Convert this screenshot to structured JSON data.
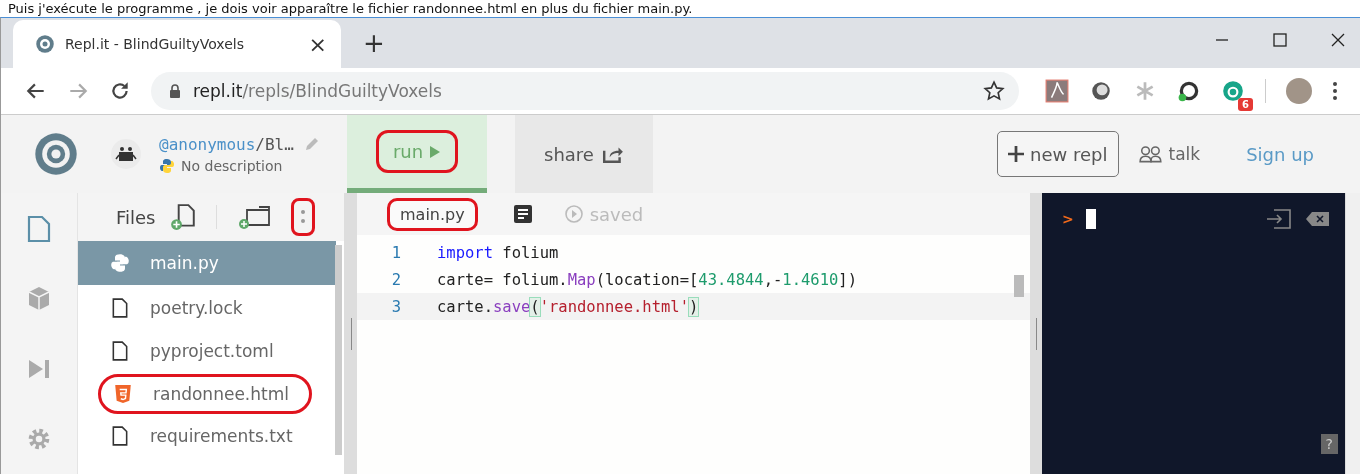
{
  "caption": "Puis j'exécute le programme , je dois voir apparaître le fichier randonnee.html en plus du fichier main.py.",
  "browser": {
    "tab_title": "Repl.it - BlindGuiltyVoxels",
    "tab_close": "×",
    "new_tab": "+",
    "url_host": "repl.it",
    "url_path": "/repls/BlindGuiltyVoxels",
    "extension_badge": "6"
  },
  "header": {
    "user": "@anonymous",
    "repl_name": "/Bl…",
    "description": "No description",
    "run": {
      "label": "run",
      "highlighted": true
    },
    "share": "share",
    "new_repl": "new repl",
    "talk": "talk",
    "sign_up": "Sign up"
  },
  "files": {
    "title": "Files",
    "menu_highlighted": true,
    "items": [
      {
        "name": "main.py",
        "kind": "python",
        "selected": true,
        "highlighted": false
      },
      {
        "name": "poetry.lock",
        "kind": "file",
        "selected": false,
        "highlighted": false
      },
      {
        "name": "pyproject.toml",
        "kind": "file",
        "selected": false,
        "highlighted": false
      },
      {
        "name": "randonnee.html",
        "kind": "html",
        "selected": false,
        "highlighted": true
      },
      {
        "name": "requirements.txt",
        "kind": "file",
        "selected": false,
        "highlighted": false
      }
    ]
  },
  "editor": {
    "tab": {
      "label": "main.py",
      "highlighted": true
    },
    "status": "saved",
    "lines": [
      {
        "number": "1",
        "tokens": [
          {
            "kind": "keyword",
            "text": "import"
          },
          {
            "kind": "plain",
            "text": " folium"
          }
        ]
      },
      {
        "number": "2",
        "tokens": [
          {
            "kind": "plain",
            "text": "carte= folium."
          },
          {
            "kind": "function",
            "text": "Map"
          },
          {
            "kind": "plain",
            "text": "(location=["
          },
          {
            "kind": "number",
            "text": "43.4844"
          },
          {
            "kind": "plain",
            "text": ",-"
          },
          {
            "kind": "number",
            "text": "1.4610"
          },
          {
            "kind": "plain",
            "text": "])"
          }
        ]
      },
      {
        "number": "3",
        "tokens": [
          {
            "kind": "plain",
            "text": "carte."
          },
          {
            "kind": "function",
            "text": "save"
          },
          {
            "kind": "bracket",
            "text": "("
          },
          {
            "kind": "string",
            "text": "'randonnee.html'"
          },
          {
            "kind": "bracket",
            "text": ")"
          }
        ]
      }
    ]
  },
  "console": {
    "prompt": ">",
    "help": "?"
  }
}
